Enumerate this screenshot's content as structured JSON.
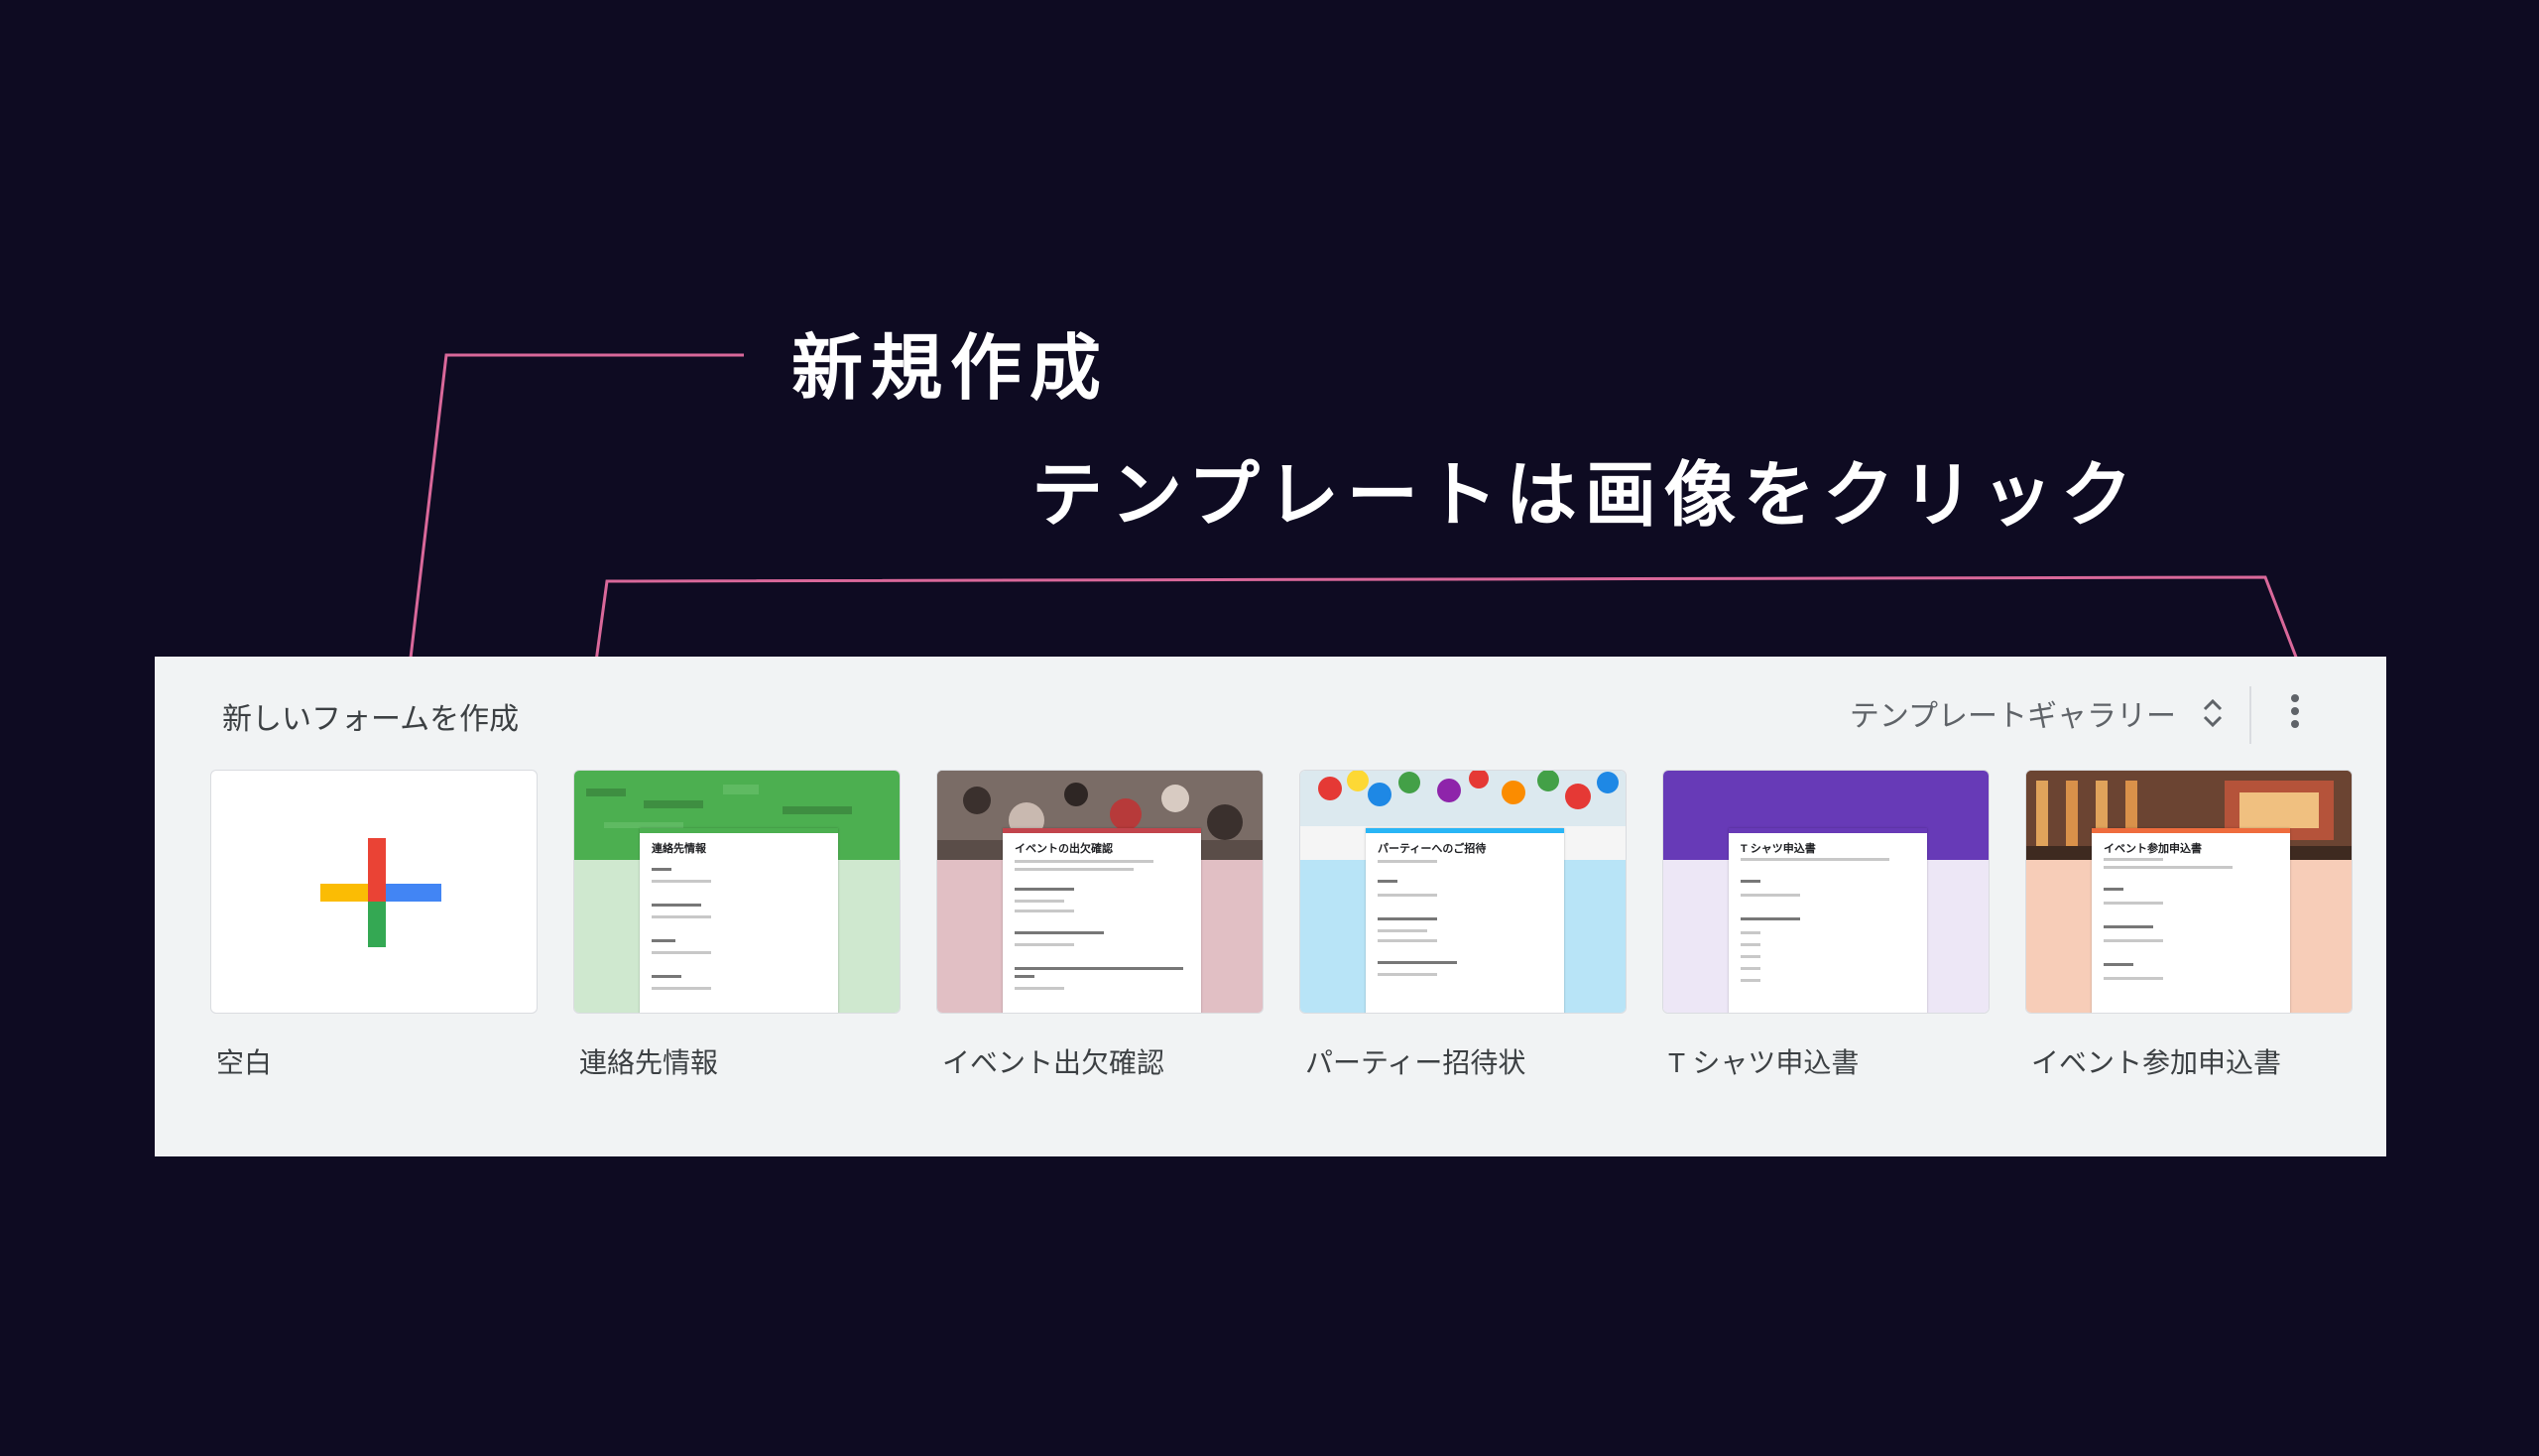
{
  "annotations": {
    "new": "新規作成",
    "template": "テンプレートは画像をクリック"
  },
  "panel": {
    "title": "新しいフォームを作成",
    "gallery_label": "テンプレートギャラリー",
    "icons": {
      "unfold": "unfold-more-icon",
      "more": "more-vert-icon",
      "plus": "plus-icon"
    }
  },
  "cards": [
    {
      "label": "空白"
    },
    {
      "label": "連絡先情報",
      "sheet_title": "連絡先情報"
    },
    {
      "label": "イベント出欠確認",
      "sheet_title": "イベントの出欠確認"
    },
    {
      "label": "パーティー招待状",
      "sheet_title": "パーティーへのご招待"
    },
    {
      "label": "T シャツ申込書",
      "sheet_title": "T シャツ申込書"
    },
    {
      "label": "イベント参加申込書",
      "sheet_title": "イベント参加申込書"
    }
  ],
  "colors": {
    "background": "#0e0b22",
    "annotation_line": "#d9689a",
    "plus_red": "#ea4335",
    "plus_blue": "#4285f4",
    "plus_green": "#34a853",
    "plus_yellow": "#fbbc04"
  }
}
